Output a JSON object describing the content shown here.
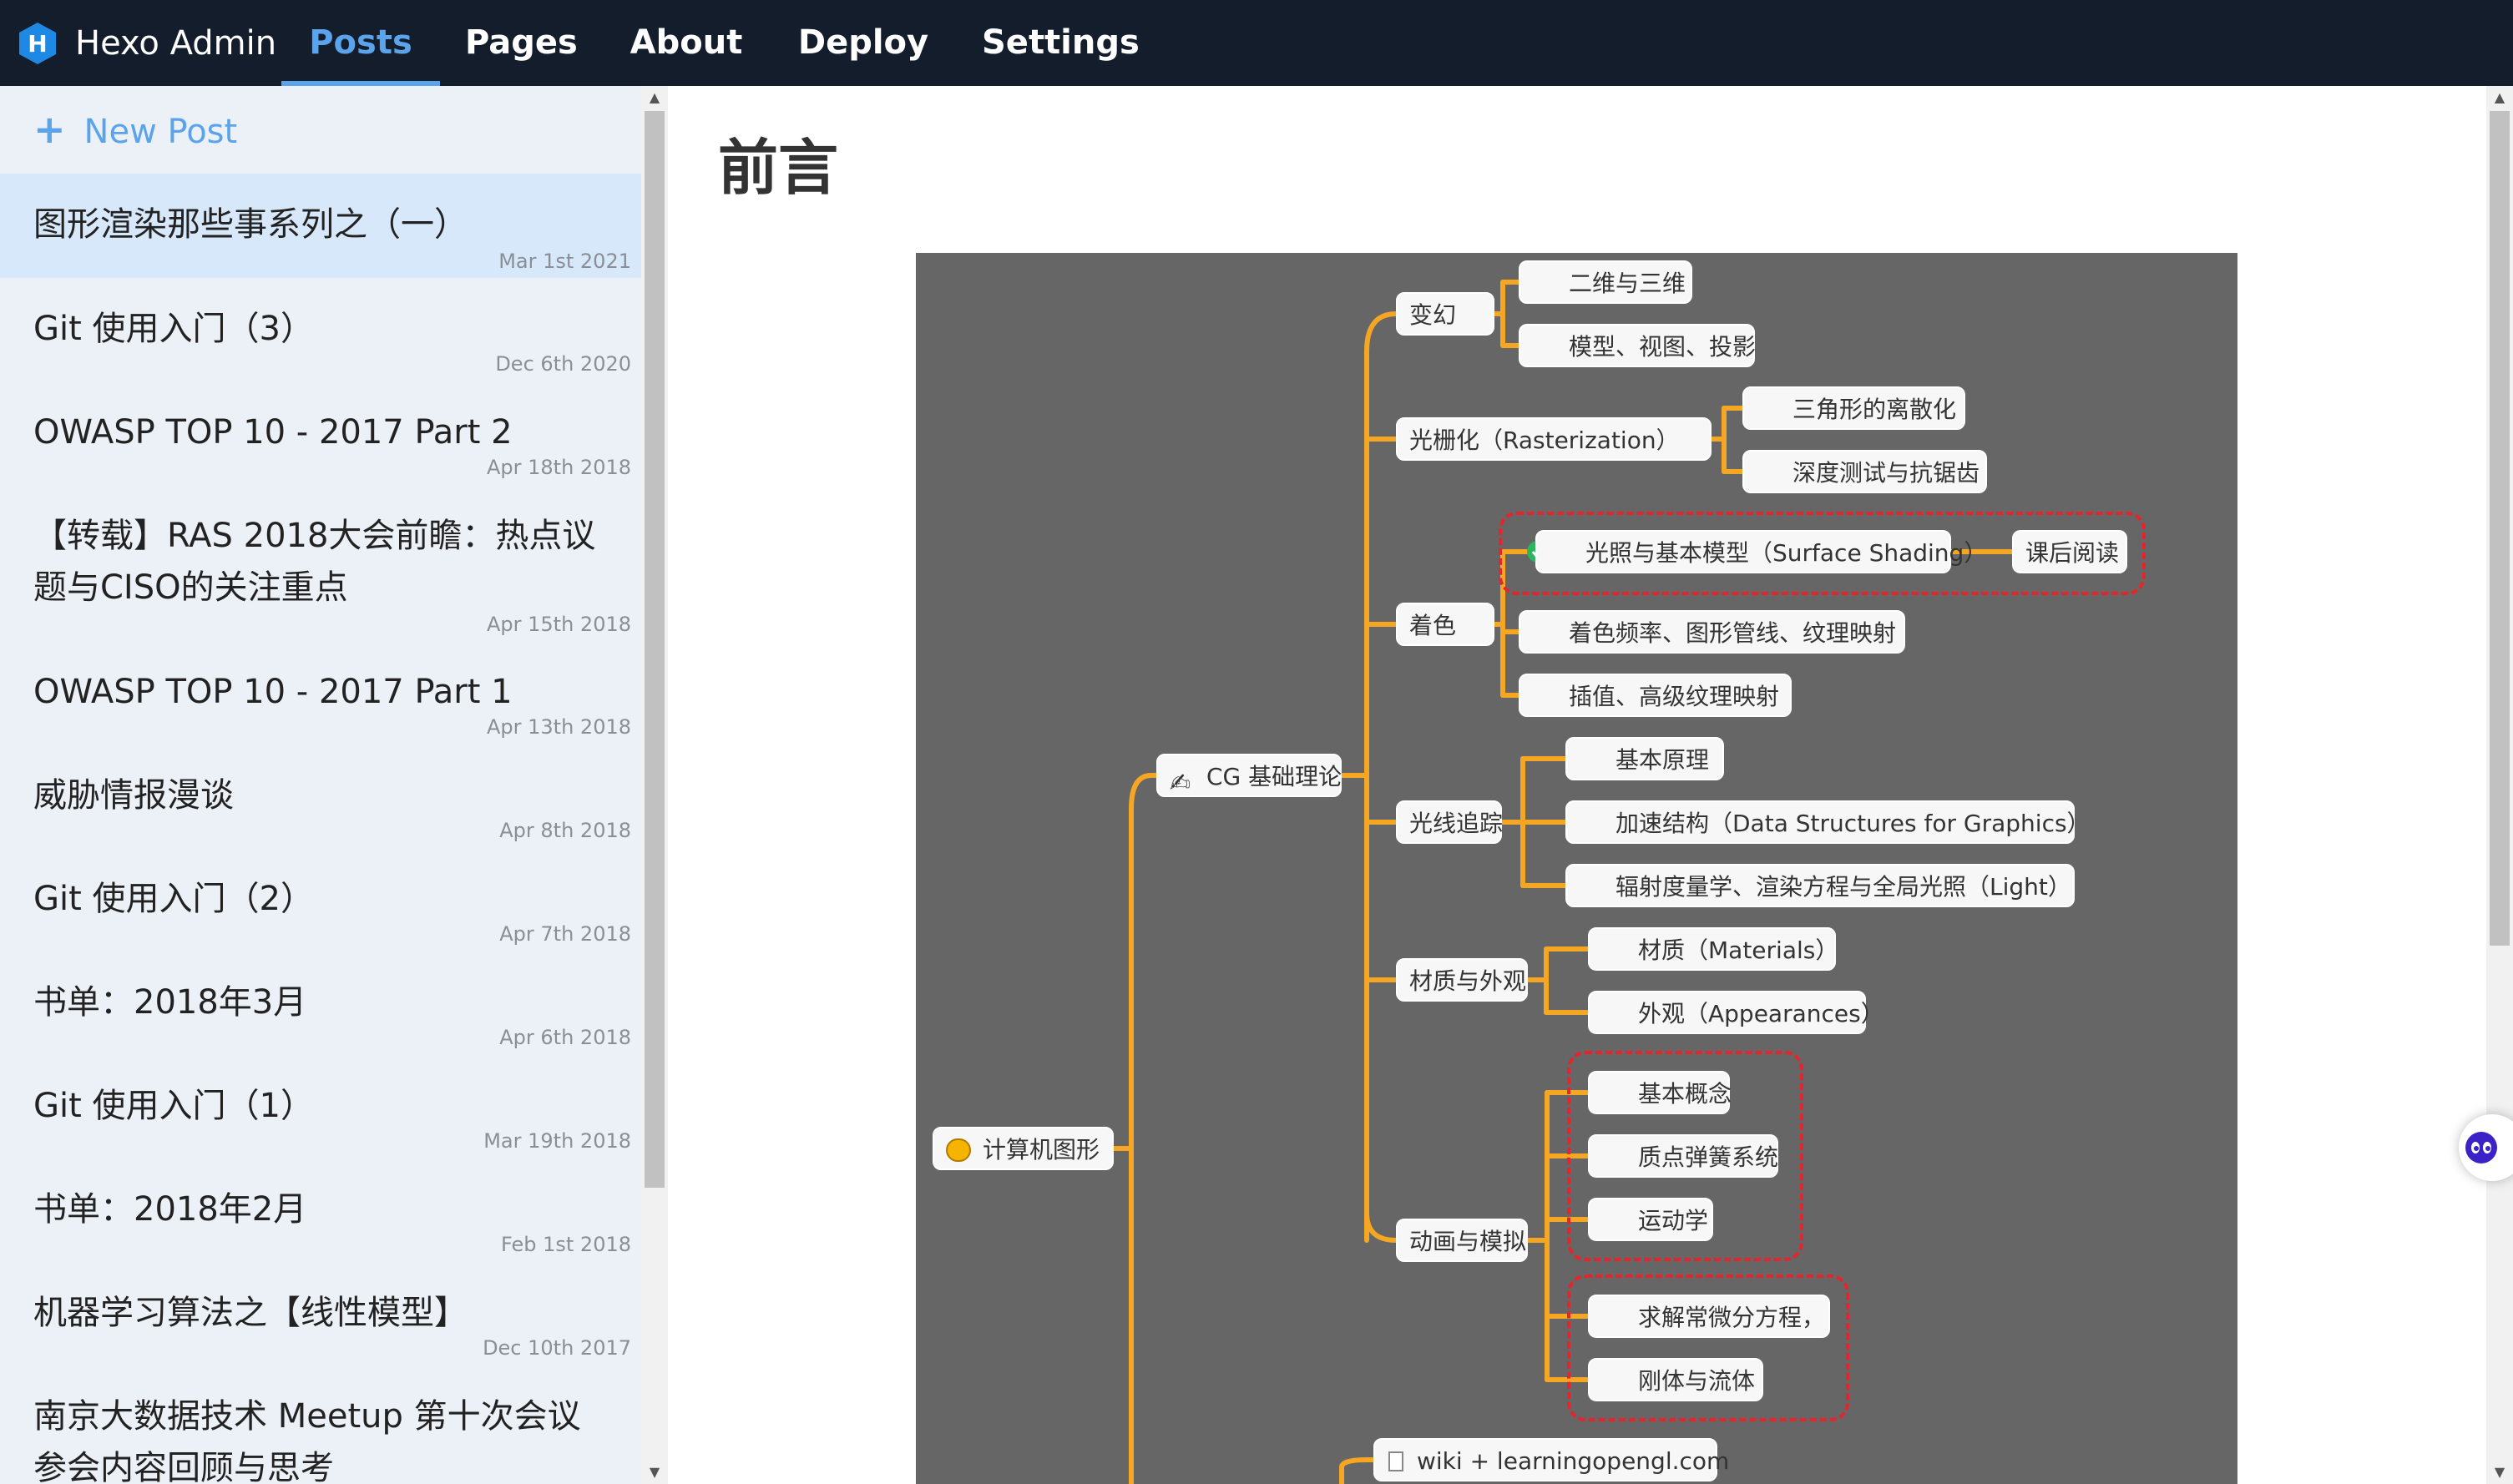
{
  "app": {
    "brand": "Hexo Admin",
    "nav": [
      {
        "label": "Posts",
        "active": true
      },
      {
        "label": "Pages",
        "active": false
      },
      {
        "label": "About",
        "active": false
      },
      {
        "label": "Deploy",
        "active": false
      },
      {
        "label": "Settings",
        "active": false
      }
    ]
  },
  "sidebar": {
    "new_post_label": "New Post",
    "posts": [
      {
        "title": "图形渲染那些事系列之（一）",
        "date": "Mar 1st 2021",
        "selected": true
      },
      {
        "title": "Git 使用入门（3）",
        "date": "Dec 6th 2020"
      },
      {
        "title": "OWASP TOP 10 - 2017 Part 2",
        "date": "Apr 18th 2018"
      },
      {
        "title": "【转载】RAS 2018大会前瞻：热点议题与CISO的关注重点",
        "date": "Apr 15th 2018"
      },
      {
        "title": "OWASP TOP 10 - 2017 Part 1",
        "date": "Apr 13th 2018"
      },
      {
        "title": "威胁情报漫谈",
        "date": "Apr 8th 2018"
      },
      {
        "title": "Git 使用入门（2）",
        "date": "Apr 7th 2018"
      },
      {
        "title": "书单：2018年3月",
        "date": "Apr 6th 2018"
      },
      {
        "title": "Git 使用入门（1）",
        "date": "Mar 19th 2018"
      },
      {
        "title": "书单：2018年2月",
        "date": "Feb 1st 2018"
      },
      {
        "title": "机器学习算法之【线性模型】",
        "date": "Dec 10th 2017"
      },
      {
        "title": "南京大数据技术 Meetup 第十次会议参会内容回顾与思考",
        "date": ""
      }
    ]
  },
  "content": {
    "heading": "前言",
    "mindmap": {
      "root": "计算机图形",
      "cg": "CG 基础理论",
      "transform": "变幻",
      "transform_items": [
        "二维与三维",
        "模型、视图、投影"
      ],
      "raster": "光栅化（Rasterization）",
      "raster_items": [
        "三角形的离散化",
        "深度测试与抗锯齿"
      ],
      "shading": "着色",
      "shading_items": [
        "光照与基本模型（Surface Shading）",
        "着色频率、图形管线、纹理映射",
        "插值、高级纹理映射"
      ],
      "shading_extra": "课后阅读",
      "raytrace": "光线追踪",
      "raytrace_items": [
        "基本原理",
        "加速结构（Data Structures for Graphics）",
        "辐射度量学、渲染方程与全局光照（Light）"
      ],
      "material": "材质与外观",
      "material_items": [
        "材质（Materials）",
        "外观（Appearances）"
      ],
      "anim": "动画与模拟",
      "anim_items": [
        "基本概念",
        "质点弹簧系统",
        "运动学",
        "求解常微分方程，",
        "刚体与流体"
      ],
      "wiki": "wiki + learningopengl.com"
    }
  },
  "colors": {
    "topbar": "#131d2c",
    "accent": "#5ba4ec",
    "sidebar_bg": "#ecf1f7",
    "selected_bg": "#d8e8fb",
    "mindmap_bg": "#666666",
    "branch": "#f5a623",
    "check": "#2db55d",
    "highlight": "#e5242b"
  },
  "icons": {
    "logo": "hexo-logo-icon",
    "new_post": "plus-icon",
    "root": "palette-icon",
    "cg": "writing-hand-icon",
    "done": "check-circle-icon",
    "todo": "play-circle-icon",
    "wiki": "document-icon",
    "assistant": "assistant-bot-icon"
  }
}
